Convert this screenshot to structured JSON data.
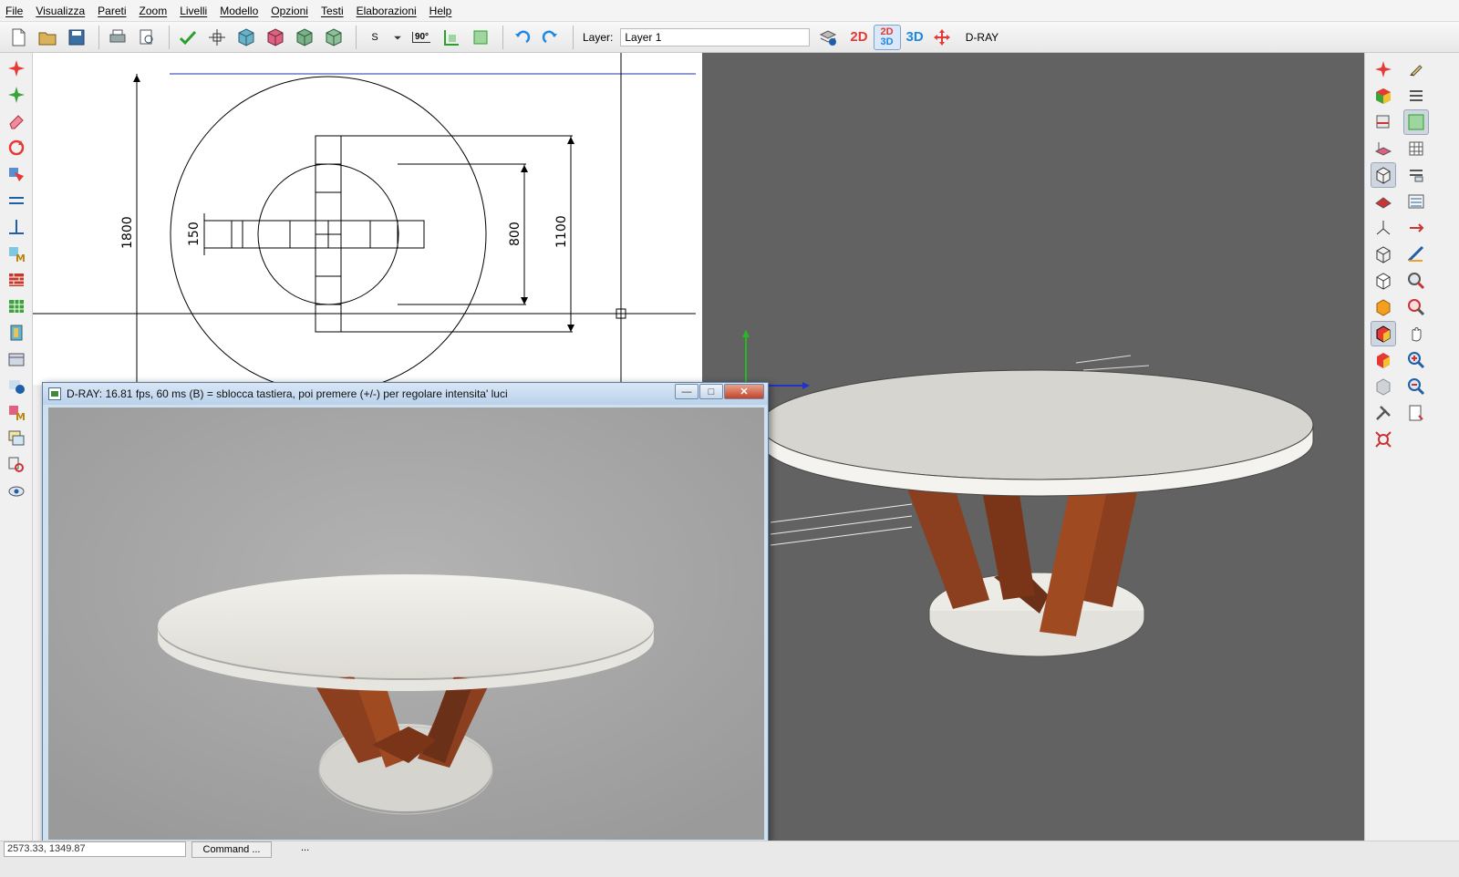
{
  "menu": [
    "File",
    "Visualizza",
    "Pareti",
    "Zoom",
    "Livelli",
    "Modello",
    "Opzioni",
    "Testi",
    "Elaborazioni",
    "Help"
  ],
  "toolbar": {
    "snap_label": "S",
    "angle_label": "90°",
    "layer_label": "Layer:",
    "layer_value": "Layer 1",
    "mode_2d": "2D",
    "mode_2d3d_top": "2D",
    "mode_2d3d_bottom": "3D",
    "mode_3d": "3D",
    "dray_label": "D-RAY"
  },
  "drawing": {
    "dims": [
      "1800",
      "150",
      "800",
      "1100"
    ]
  },
  "dray_window": {
    "title": "D-RAY: 16.81 fps, 60 ms  (B) = sblocca tastiera, poi premere (+/-) per regolare intensita' luci",
    "min_label": "—",
    "max_label": "□",
    "close_label": "✕"
  },
  "status": {
    "coords": "2573.33, 1349.87",
    "command": "Command ...",
    "dots": "..."
  },
  "colors": {
    "accent_red": "#e53935",
    "accent_blue": "#1e88e5",
    "wood": "#8b3f1f",
    "tabletop": "#e8e6df",
    "bg3d": "#626262"
  }
}
